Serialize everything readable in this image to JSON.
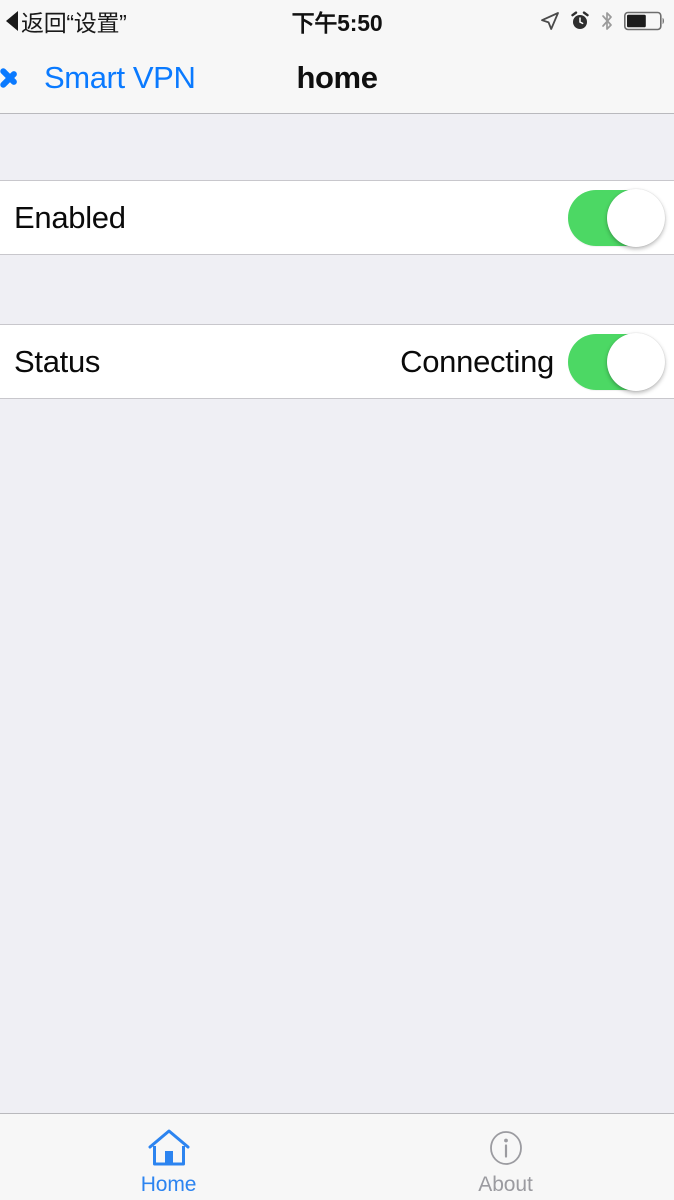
{
  "status_bar": {
    "back_to_app": "◀返回“设置”",
    "back_label": "返回“设置”",
    "time": "下午5:50",
    "icons": [
      {
        "name": "location-arrow-icon"
      },
      {
        "name": "alarm-clock-icon"
      },
      {
        "name": "bluetooth-icon"
      },
      {
        "name": "battery-icon",
        "level_percent": 55
      }
    ]
  },
  "nav_bar": {
    "back_button_label": "Smart VPN",
    "back_icon": "chevron-left-icon",
    "title": "home"
  },
  "table": {
    "sections": [
      {
        "rows": [
          {
            "title": "Enabled",
            "value": "",
            "toggle": {
              "state": "on",
              "color": "#4CD864"
            }
          }
        ]
      },
      {
        "rows": [
          {
            "title": "Status",
            "value": "Connecting",
            "toggle": {
              "state": "on",
              "color": "#4CD864"
            }
          }
        ]
      }
    ]
  },
  "tab_bar": {
    "items": [
      {
        "label": "Home",
        "icon": "home-icon",
        "active": true,
        "color": "#2C84F0"
      },
      {
        "label": "About",
        "icon": "info-circle-icon",
        "active": false,
        "color": "#9B9BA0"
      }
    ]
  },
  "colors": {
    "accent_blue": "#0A7AFF",
    "toggle_green": "#4CD864",
    "background": "#EFEFF4",
    "bar_background": "#F7F7F7",
    "separator": "#C8C7CC"
  }
}
